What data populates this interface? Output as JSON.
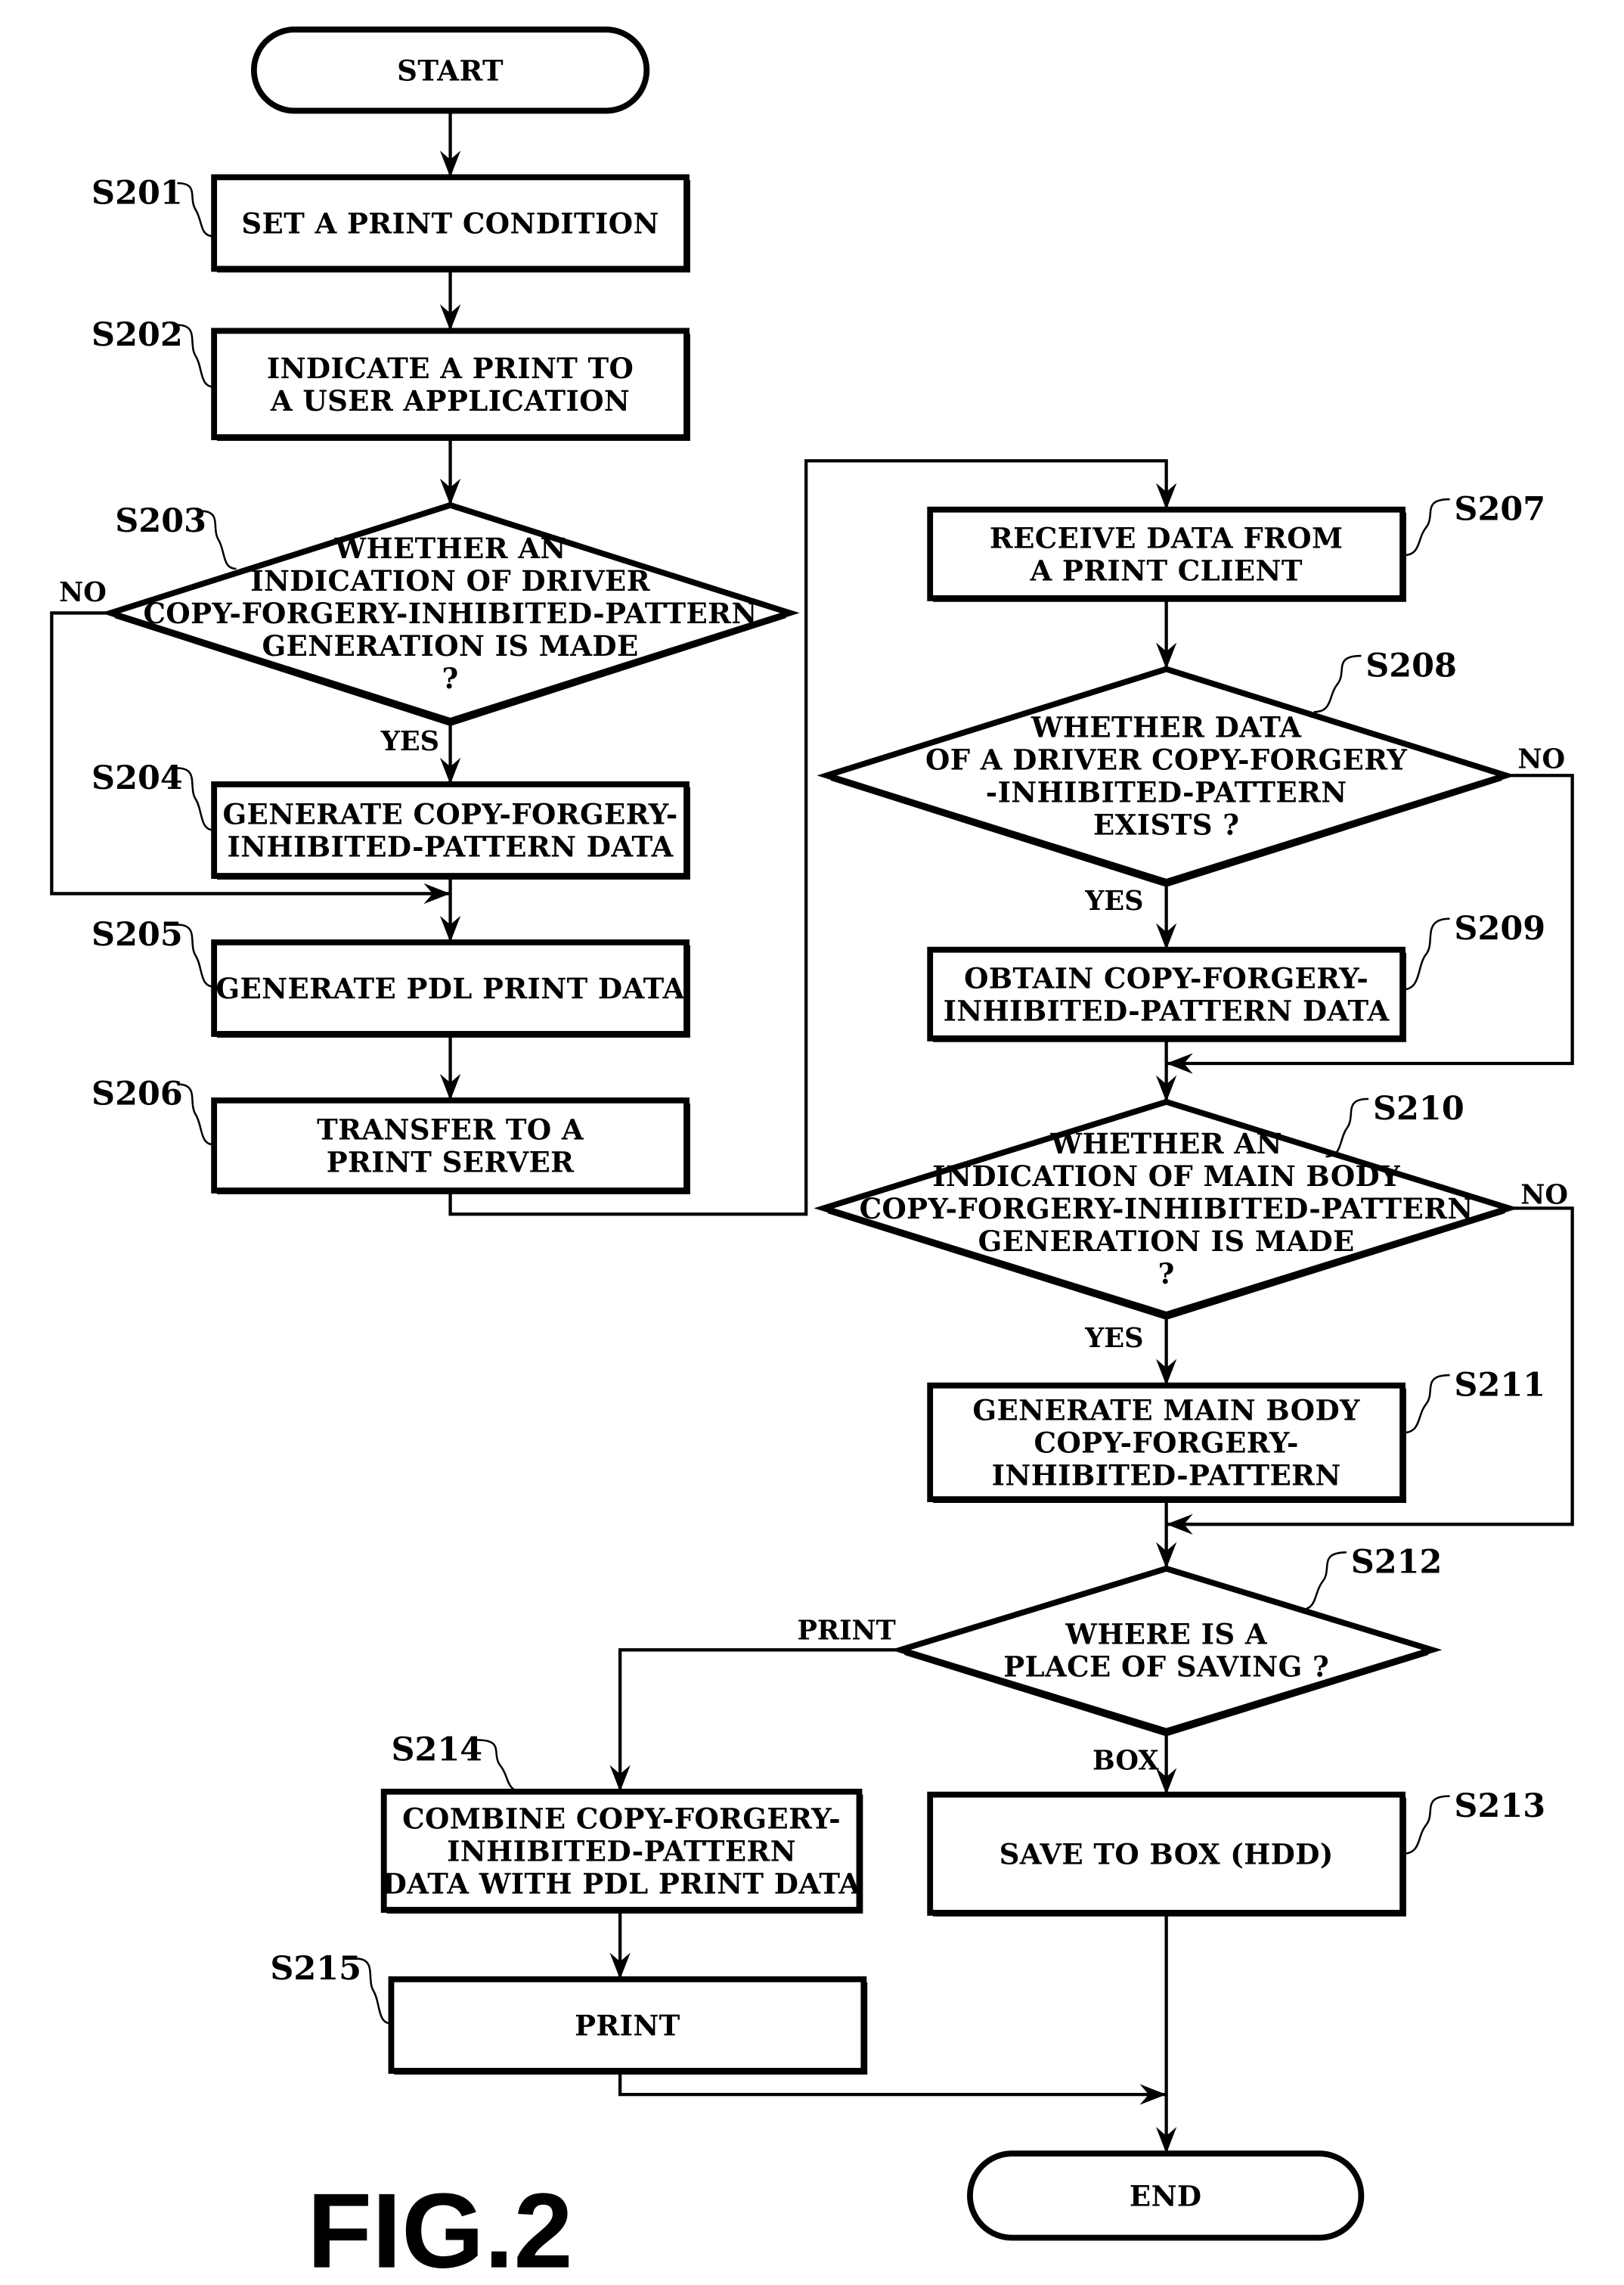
{
  "figure": {
    "label": "FIG.2",
    "colors": {
      "stroke": "#000000",
      "background": "#ffffff"
    }
  },
  "nodes": {
    "start": {
      "type": "terminal",
      "lines": [
        "START"
      ]
    },
    "s201": {
      "step": "S201",
      "type": "process",
      "lines": [
        "SET A PRINT CONDITION"
      ]
    },
    "s202": {
      "step": "S202",
      "type": "process",
      "lines": [
        "INDICATE A PRINT TO",
        "A USER APPLICATION"
      ]
    },
    "s203": {
      "step": "S203",
      "type": "decision",
      "lines": [
        "WHETHER AN",
        "INDICATION OF DRIVER",
        "COPY-FORGERY-INHIBITED-PATTERN",
        "GENERATION IS MADE",
        "?"
      ]
    },
    "s204": {
      "step": "S204",
      "type": "process",
      "lines": [
        "GENERATE COPY-FORGERY-",
        "INHIBITED-PATTERN DATA"
      ]
    },
    "s205": {
      "step": "S205",
      "type": "process",
      "lines": [
        "GENERATE PDL PRINT DATA"
      ]
    },
    "s206": {
      "step": "S206",
      "type": "process",
      "lines": [
        "TRANSFER TO A",
        "PRINT SERVER"
      ]
    },
    "s207": {
      "step": "S207",
      "type": "process",
      "lines": [
        "RECEIVE DATA FROM",
        "A PRINT CLIENT"
      ]
    },
    "s208": {
      "step": "S208",
      "type": "decision",
      "lines": [
        "WHETHER DATA",
        "OF A DRIVER COPY-FORGERY",
        "-INHIBITED-PATTERN",
        "EXISTS ?"
      ]
    },
    "s209": {
      "step": "S209",
      "type": "process",
      "lines": [
        "OBTAIN COPY-FORGERY-",
        "INHIBITED-PATTERN DATA"
      ]
    },
    "s210": {
      "step": "S210",
      "type": "decision",
      "lines": [
        "WHETHER AN",
        "INDICATION OF MAIN BODY",
        "COPY-FORGERY-INHIBITED-PATTERN",
        "GENERATION IS MADE",
        "?"
      ]
    },
    "s211": {
      "step": "S211",
      "type": "process",
      "lines": [
        "GENERATE MAIN BODY",
        "COPY-FORGERY-",
        "INHIBITED-PATTERN"
      ]
    },
    "s212": {
      "step": "S212",
      "type": "decision",
      "lines": [
        "WHERE IS A",
        "PLACE OF SAVING ?"
      ]
    },
    "s213": {
      "step": "S213",
      "type": "process",
      "lines": [
        "SAVE TO BOX (HDD)"
      ]
    },
    "s214": {
      "step": "S214",
      "type": "process",
      "lines": [
        "COMBINE COPY-FORGERY-",
        "INHIBITED-PATTERN",
        "DATA WITH PDL PRINT DATA"
      ]
    },
    "s215": {
      "step": "S215",
      "type": "process",
      "lines": [
        "PRINT"
      ]
    },
    "end": {
      "type": "terminal",
      "lines": [
        "END"
      ]
    }
  },
  "edges": [
    {
      "from": "start",
      "to": "s201"
    },
    {
      "from": "s201",
      "to": "s202"
    },
    {
      "from": "s202",
      "to": "s203"
    },
    {
      "from": "s203",
      "to": "s204",
      "label": "YES"
    },
    {
      "from": "s203",
      "to": "s205",
      "label": "NO"
    },
    {
      "from": "s204",
      "to": "s205"
    },
    {
      "from": "s205",
      "to": "s206"
    },
    {
      "from": "s206",
      "to": "s207"
    },
    {
      "from": "s207",
      "to": "s208"
    },
    {
      "from": "s208",
      "to": "s209",
      "label": "YES"
    },
    {
      "from": "s208",
      "to": "s210",
      "label": "NO"
    },
    {
      "from": "s209",
      "to": "s210"
    },
    {
      "from": "s210",
      "to": "s211",
      "label": "YES"
    },
    {
      "from": "s210",
      "to": "s212",
      "label": "NO"
    },
    {
      "from": "s211",
      "to": "s212"
    },
    {
      "from": "s212",
      "to": "s213",
      "label": "BOX"
    },
    {
      "from": "s212",
      "to": "s214",
      "label": "PRINT"
    },
    {
      "from": "s214",
      "to": "s215"
    },
    {
      "from": "s215",
      "to": "end"
    },
    {
      "from": "s213",
      "to": "end"
    }
  ],
  "branch_labels": {
    "s203_no": "NO",
    "s203_yes": "YES",
    "s208_no": "NO",
    "s208_yes": "YES",
    "s210_no": "NO",
    "s210_yes": "YES",
    "s212_print": "PRINT",
    "s212_box": "BOX"
  }
}
